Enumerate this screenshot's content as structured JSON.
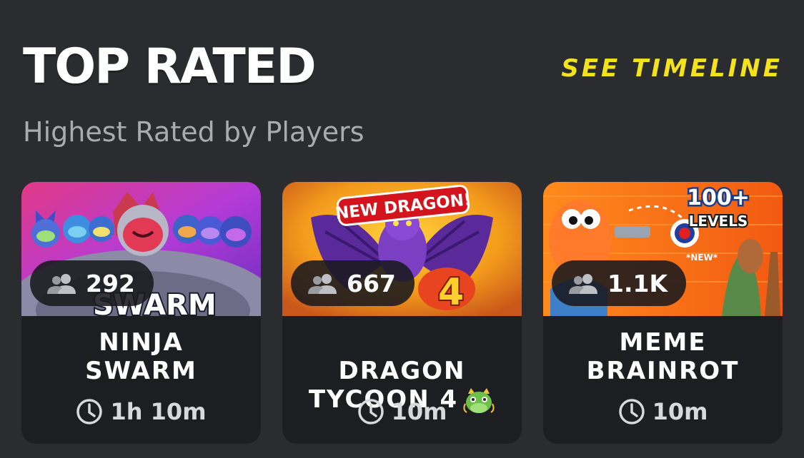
{
  "section": {
    "title": "TOP RATED",
    "subtitle": "Highest Rated by Players",
    "see_timeline_label": "SEE TIMELINE"
  },
  "colors": {
    "background": "#2b2c30",
    "card_background": "#1d1e21",
    "accent_yellow": "#f4e21a",
    "subtitle_gray": "#a9abb0"
  },
  "cards": [
    {
      "name": "NINJA\nSWARM",
      "players": "292",
      "duration": "1h 10m",
      "thumbnail_text": "SWARM",
      "player_icon": "people-icon",
      "clock_icon": "clock-icon"
    },
    {
      "name": "DRAGON\nTYCOON 4",
      "name_emoji": "dragon-face-icon",
      "players": "667",
      "duration": "10m",
      "thumbnail_banner": "NEW DRAGON!",
      "player_icon": "people-icon",
      "clock_icon": "clock-icon"
    },
    {
      "name": "MEME\nBRAINROT",
      "players": "1.1K",
      "duration": "10m",
      "thumbnail_badge_top": "100+",
      "thumbnail_badge_bottom": "LEVELS",
      "thumbnail_new": "*NEW*",
      "player_icon": "people-icon",
      "clock_icon": "clock-icon"
    }
  ]
}
